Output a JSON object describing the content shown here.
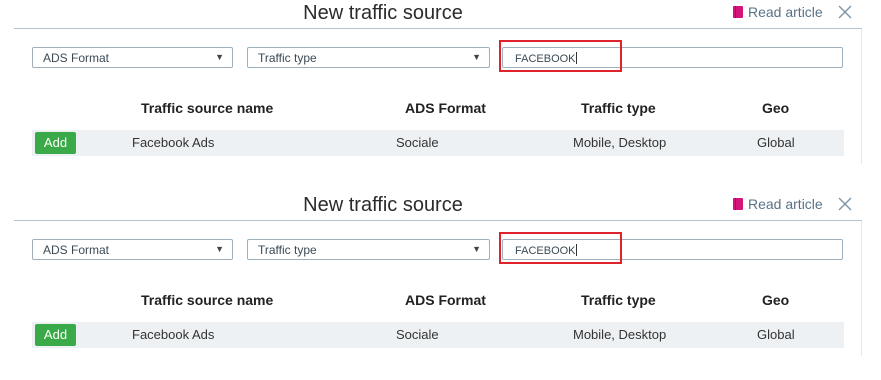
{
  "panels": [
    {
      "title": "New traffic source",
      "read_article": "Read article",
      "filters": {
        "ads_format": "ADS Format",
        "traffic_type": "Traffic type",
        "search_value": "FACEBOOK"
      },
      "table": {
        "headers": [
          "Traffic source name",
          "ADS Format",
          "Traffic type",
          "Geo"
        ],
        "rows": [
          {
            "action": "Add",
            "name": "Facebook Ads",
            "ads_format": "Sociale",
            "traffic_type": "Mobile, Desktop",
            "geo": "Global"
          }
        ]
      }
    },
    {
      "title": "New traffic source",
      "read_article": "Read article",
      "filters": {
        "ads_format": "ADS Format",
        "traffic_type": "Traffic type",
        "search_value": "FACEBOOK"
      },
      "table": {
        "headers": [
          "Traffic source name",
          "ADS Format",
          "Traffic type",
          "Geo"
        ],
        "rows": [
          {
            "action": "Add",
            "name": "Facebook Ads",
            "ads_format": "Sociale",
            "traffic_type": "Mobile, Desktop",
            "geo": "Global"
          }
        ]
      }
    }
  ],
  "colors": {
    "accent_add": "#3aaa48",
    "highlight": "#e0232a",
    "book_icon": "#d4147a"
  }
}
